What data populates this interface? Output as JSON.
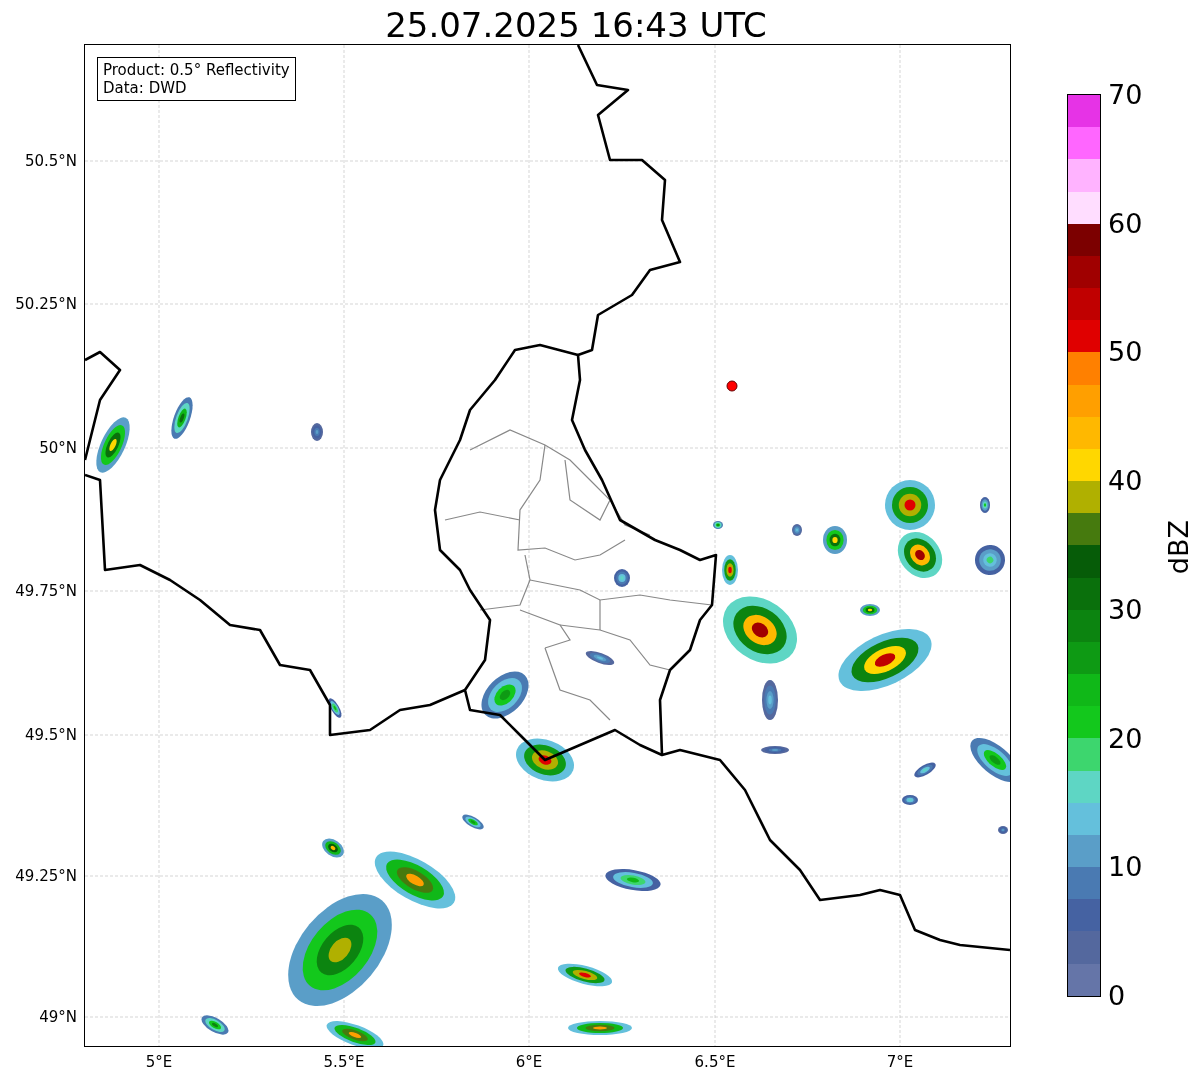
{
  "title": "25.07.2025 16:43 UTC",
  "info_box": {
    "lines": [
      "Product: 0.5° Reflectivity",
      "Data: DWD"
    ]
  },
  "map": {
    "xticks": [
      "5°E",
      "5.5°E",
      "6°E",
      "6.5°E",
      "7°E"
    ],
    "yticks": [
      "50.5°N",
      "50.25°N",
      "50°N",
      "49.75°N",
      "49.5°N",
      "49.25°N",
      "49°N"
    ]
  },
  "colorbar": {
    "label": "dBZ",
    "segments": [
      {
        "color": "#6575a8"
      },
      {
        "color": "#54689e"
      },
      {
        "color": "#4562a2"
      },
      {
        "color": "#4a7ab2"
      },
      {
        "color": "#5a9ec8"
      },
      {
        "color": "#64c0dc"
      },
      {
        "color": "#5ed6c4"
      },
      {
        "color": "#3dd66e"
      },
      {
        "color": "#13c81c"
      },
      {
        "color": "#10b818"
      },
      {
        "color": "#0e9a14"
      },
      {
        "color": "#0c8410"
      },
      {
        "color": "#0a700c"
      },
      {
        "color": "#065c08"
      },
      {
        "color": "#467a0e"
      },
      {
        "color": "#b0b000"
      },
      {
        "color": "#ffd700"
      },
      {
        "color": "#ffb800"
      },
      {
        "color": "#ff9f00"
      },
      {
        "color": "#ff8000"
      },
      {
        "color": "#e00000"
      },
      {
        "color": "#c00000"
      },
      {
        "color": "#a00000"
      },
      {
        "color": "#7c0000"
      },
      {
        "color": "#ffddff"
      },
      {
        "color": "#ffb3ff"
      },
      {
        "color": "#ff66ff"
      },
      {
        "color": "#e633e6"
      }
    ],
    "ticks": [
      "70",
      "60",
      "50",
      "40",
      "30",
      "20",
      "10",
      "0"
    ]
  }
}
